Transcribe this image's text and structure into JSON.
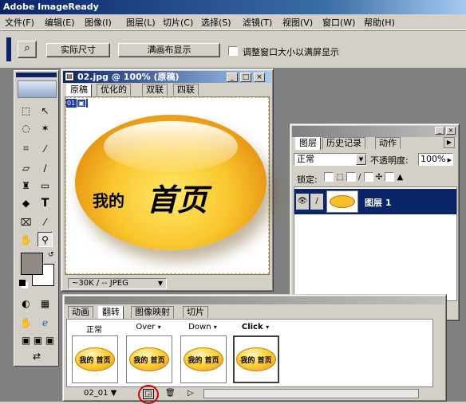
{
  "app": {
    "title": "Adobe ImageReady"
  },
  "menu": [
    "文件(F)",
    "编辑(E)",
    "图像(I)",
    "图层(L)",
    "切片(C)",
    "选择(S)",
    "滤镜(T)",
    "视图(V)",
    "窗口(W)",
    "帮助(H)"
  ],
  "options": {
    "actual_pixels": "实际尺寸",
    "fit_canvas": "满画布显示",
    "resize_window": "调整窗口大小以满屏显示"
  },
  "doc": {
    "title": "02.jpg @ 100% (原稿)",
    "tabs": [
      "原稿",
      "优化的",
      "双联",
      "四联"
    ],
    "slice_badge": "01",
    "status": "~30K / -- JPEG",
    "button_text_small": "我的",
    "button_text_big": "首页"
  },
  "layers": {
    "tabs": [
      "图层",
      "历史记录",
      "动作"
    ],
    "blend": "正常",
    "opacity_label": "不透明度:",
    "opacity": "100%",
    "lock_label": "锁定:",
    "layer_name": "图层 1"
  },
  "rollover": {
    "tabs": [
      "动画",
      "翻转",
      "图像映射",
      "切片"
    ],
    "states": [
      "正常",
      "Over",
      "Down",
      "Click"
    ],
    "state_arrow": "▾",
    "slice_name": "02_01",
    "mini_text": "我的 首页"
  }
}
